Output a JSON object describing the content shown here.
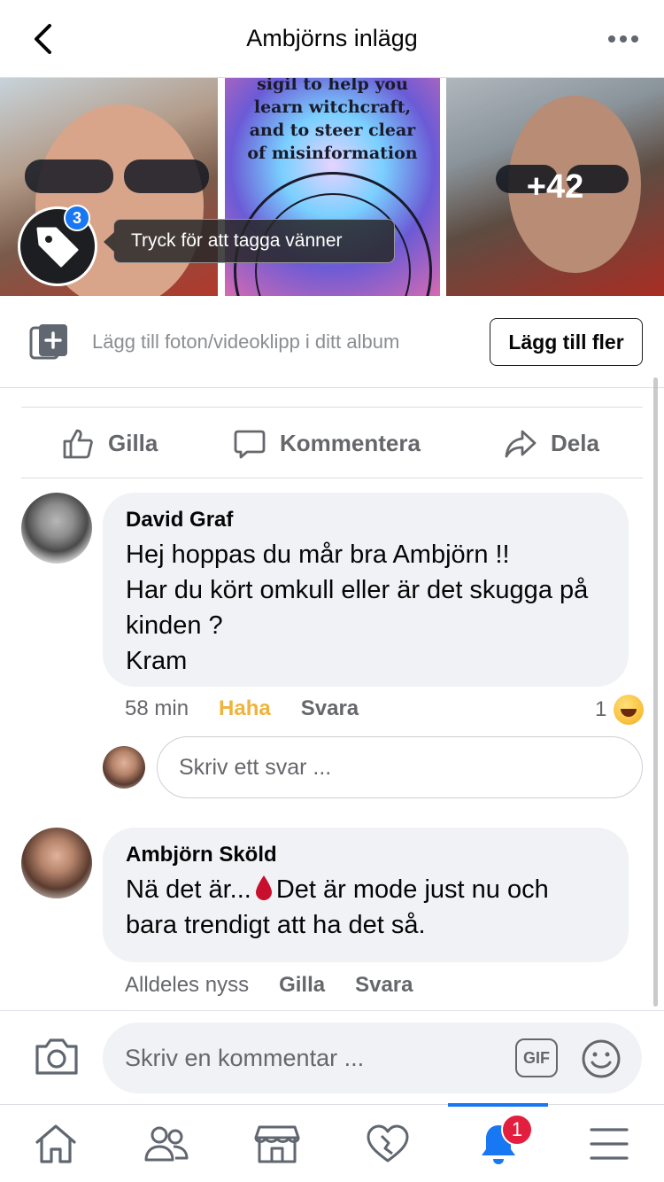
{
  "header": {
    "title": "Ambjörns inlägg",
    "back_icon": "chevron-left-icon",
    "more_icon": "more-horizontal-icon"
  },
  "photos": {
    "middle_text": "sigil to help you\nlearn witchcraft,\nand to steer clear\nof misinformation",
    "extra_count": "+42",
    "tag_badge_count": "3",
    "tag_tooltip": "Tryck för att tagga vänner"
  },
  "add_photos": {
    "text": "Lägg till foton/videoklipp i ditt album",
    "button_label": "Lägg till fler"
  },
  "actions": {
    "like": "Gilla",
    "comment": "Kommentera",
    "share": "Dela"
  },
  "comments": [
    {
      "author": "David Graf",
      "text": "Hej hoppas du mår bra Ambjörn !!\nHar du kört omkull eller är det skugga på kinden ?\nKram",
      "time": "58 min",
      "reaction_action": "Haha",
      "reply_label": "Svara",
      "reaction_count": "1"
    },
    {
      "author": "Ambjörn Sköld",
      "text_before": "Nä det är...",
      "text_after": "Det är mode just nu och bara trendigt att ha det så.",
      "time": "Alldeles nyss",
      "like_label": "Gilla",
      "reply_label": "Svara"
    }
  ],
  "reply_input": {
    "placeholder": "Skriv ett svar ..."
  },
  "comment_bar": {
    "placeholder": "Skriv en kommentar ...",
    "gif_label": "GIF"
  },
  "nav": {
    "notifications_badge": "1",
    "active_tab": "notifications"
  },
  "colors": {
    "accent": "#1877f2",
    "haha": "#f0b33b",
    "badge_red": "#e41e3f",
    "bubble_bg": "#f0f2f5"
  }
}
